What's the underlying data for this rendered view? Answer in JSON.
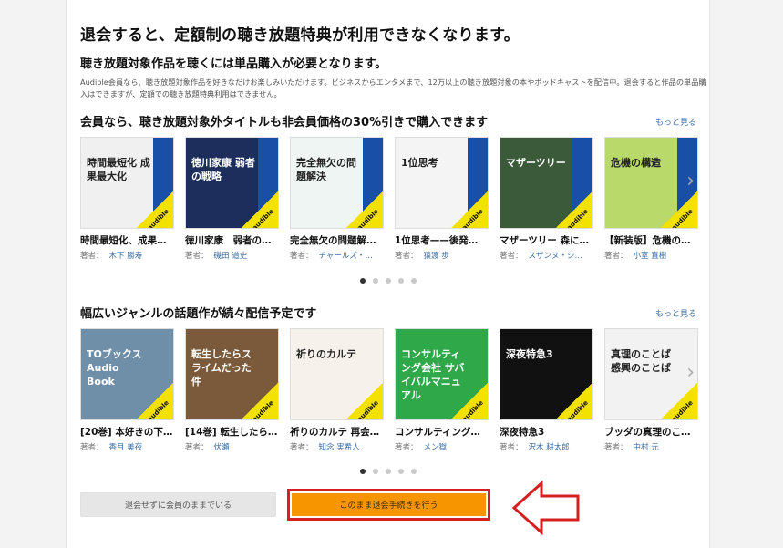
{
  "header": {
    "title": "退会すると、定額制の聴き放題特典が利用できなくなります。",
    "subtitle": "聴き放題対象作品を聴くには単品購入が必要となります。",
    "description": "Audible会員なら、聴き放題対象作品を好きなだけお楽しみいただけます。ビジネスからエンタメまで、12万以上の聴き放題対象の本やポッドキャストを配信中。退会すると作品の単品購入はできますが、定額での聴き放題特典利用はできません。"
  },
  "section1": {
    "title": "会員なら、聴き放題対象外タイトルも非会員価格の30%引きで購入できます",
    "more_label": "もっと見る",
    "author_prefix": "著者：",
    "books": [
      {
        "title": "時間最短化、成果…",
        "author": "木下 勝寿",
        "cover_text": "時間最短化 成果最大化",
        "cover_color": "#f0f0f0"
      },
      {
        "title": "徳川家康　弱者の…",
        "author": "磯田 道史",
        "cover_text": "徳川家康 弱者の戦略",
        "cover_color": "#1d2d5c"
      },
      {
        "title": "完全無欠の問題解…",
        "author": "チャールズ・…",
        "cover_text": "完全無欠の問題解決",
        "cover_color": "#eef5f3"
      },
      {
        "title": "1位思考——後発…",
        "author": "猿渡 歩",
        "cover_text": "1位思考",
        "cover_color": "#f4f4f4"
      },
      {
        "title": "マザーツリー 森に…",
        "author": "スザンヌ・シ…",
        "cover_text": "マザーツリー",
        "cover_color": "#3b5a3a"
      },
      {
        "title": "【新装版】危機の…",
        "author": "小室 直樹",
        "cover_text": "危機の構造",
        "cover_color": "#b9d96a"
      }
    ],
    "dots_count": 5
  },
  "section2": {
    "title": "幅広いジャンルの話題作が続々配信予定です",
    "more_label": "もっと見る",
    "author_prefix": "著者：",
    "books": [
      {
        "title": "[20巻] 本好きの下…",
        "author": "香月 美夜",
        "cover_text": "TOブックス Audio Book",
        "cover_color": "#6f8fa8"
      },
      {
        "title": "[14巻] 転生したら…",
        "author": "伏瀬",
        "cover_text": "転生したらスライムだった件",
        "cover_color": "#7a5a3a"
      },
      {
        "title": "祈りのカルテ 再会…",
        "author": "知念 実希人",
        "cover_text": "祈りのカルテ",
        "cover_color": "#f6f1ea"
      },
      {
        "title": "コンサルティング…",
        "author": "メン獄",
        "cover_text": "コンサルティング会社 サバイバルマニュアル",
        "cover_color": "#2fa84a"
      },
      {
        "title": "深夜特急3",
        "author": "沢木 耕太郎",
        "cover_text": "深夜特急3",
        "cover_color": "#111111"
      },
      {
        "title": "ブッダの真理のこ…",
        "author": "中村 元",
        "cover_text": "真理のことば 感興のことば",
        "cover_color": "#f2f2f2"
      }
    ],
    "dots_count": 5
  },
  "actions": {
    "stay_label": "退会せずに会員のままでいる",
    "cancel_label": "このまま退会手続きを行う"
  },
  "colors": {
    "accent_orange": "#f79500",
    "highlight_red": "#d42020",
    "link_blue": "#3a6ea5",
    "audible_blue": "#1a4fa8",
    "audible_yellow": "#f3e100"
  }
}
